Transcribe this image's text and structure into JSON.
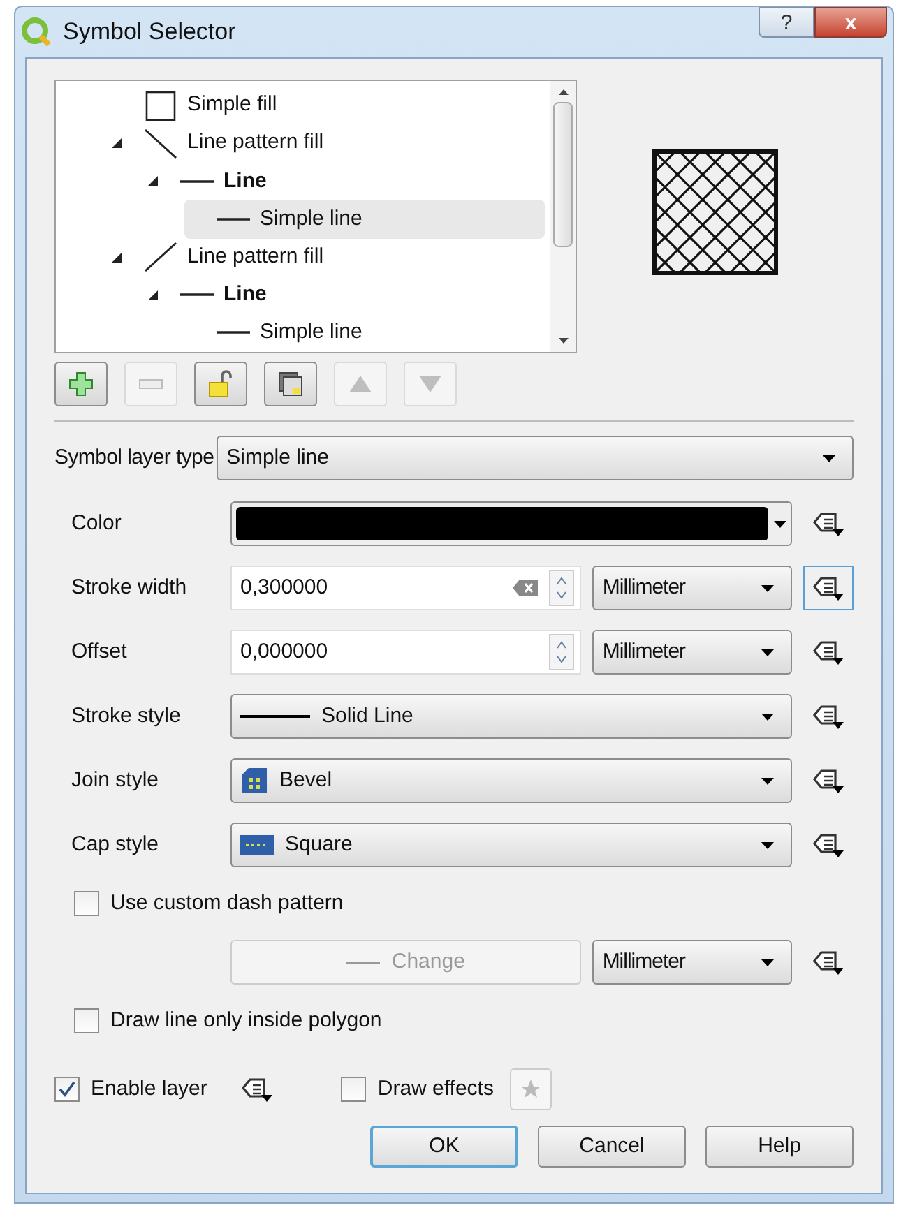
{
  "window": {
    "title": "Symbol Selector",
    "help": "?",
    "close": "x"
  },
  "tree": [
    {
      "label": "Simple fill",
      "kind": "fill",
      "bold": false,
      "selected": false
    },
    {
      "label": "Line pattern fill",
      "kind": "backslash",
      "bold": false,
      "selected": false,
      "expanded": true,
      "children": [
        {
          "label": "Line",
          "kind": "dash",
          "bold": true,
          "selected": false,
          "expanded": true,
          "children": [
            {
              "label": "Simple line",
              "kind": "dash",
              "bold": false,
              "selected": true
            }
          ]
        }
      ]
    },
    {
      "label": "Line pattern fill",
      "kind": "slash",
      "bold": false,
      "selected": false,
      "expanded": true,
      "children": [
        {
          "label": "Line",
          "kind": "dash",
          "bold": true,
          "selected": false,
          "expanded": true,
          "children": [
            {
              "label": "Simple line",
              "kind": "dash",
              "bold": false,
              "selected": false
            }
          ]
        }
      ]
    }
  ],
  "tree_buttons": [
    {
      "kind": "add",
      "disabled": false
    },
    {
      "kind": "remove",
      "disabled": true
    },
    {
      "kind": "lock",
      "disabled": false
    },
    {
      "kind": "duplicate",
      "disabled": false
    },
    {
      "kind": "up",
      "disabled": true
    },
    {
      "kind": "down",
      "disabled": true
    }
  ],
  "layer_type": {
    "label": "Symbol layer type",
    "value": "Simple line"
  },
  "rows": [
    {
      "kind": "color",
      "label": "Color",
      "color": "#000000"
    },
    {
      "kind": "spin",
      "label": "Stroke width",
      "value": "0,300000",
      "clearable": true,
      "unit": "Millimeter",
      "focused": true
    },
    {
      "kind": "spin",
      "label": "Offset",
      "value": "0,000000",
      "clearable": false,
      "unit": "Millimeter",
      "focused": false
    },
    {
      "kind": "combo",
      "label": "Stroke style",
      "value": "Solid Line"
    },
    {
      "kind": "combo",
      "label": "Join style",
      "value": "Bevel"
    },
    {
      "kind": "combo",
      "label": "Cap style",
      "value": "Square"
    },
    {
      "kind": "checkbox",
      "label": "Use custom dash pattern",
      "checked": false
    },
    {
      "kind": "change",
      "value": "Change",
      "disabled": true,
      "unit": "Millimeter"
    },
    {
      "kind": "checkbox",
      "label": "Draw line only inside polygon",
      "checked": false
    }
  ],
  "enable_layer": {
    "label": "Enable layer",
    "checked": true
  },
  "draw_effects": {
    "label": "Draw effects",
    "checked": false
  },
  "buttons": [
    {
      "label": "OK",
      "default": true
    },
    {
      "label": "Cancel",
      "default": false
    },
    {
      "label": "Help",
      "default": false
    }
  ]
}
